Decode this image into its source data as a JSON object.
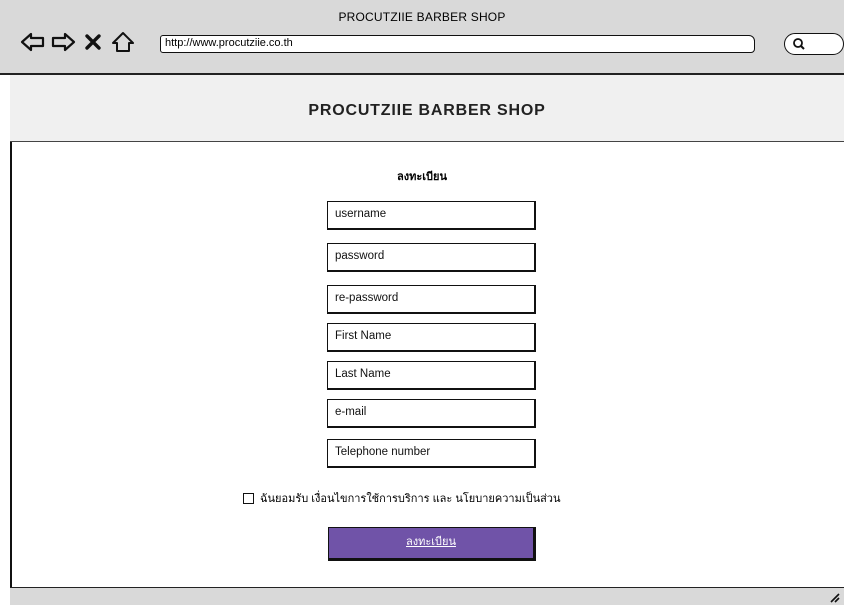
{
  "window": {
    "title": "PROCUTZIIE BARBER SHOP",
    "url": "http://www.procutziie.co.th"
  },
  "nav_icons": [
    "back-arrow-icon",
    "forward-arrow-icon",
    "close-icon",
    "home-icon"
  ],
  "header": {
    "title": "PROCUTZIIE BARBER SHOP"
  },
  "form": {
    "title": "ลงทะเบียน",
    "fields": {
      "username": "username",
      "password": "password",
      "repassword": "re-password",
      "firstname": "First Name",
      "lastname": "Last Name",
      "email": "e-mail",
      "telephone": "Telephone number"
    },
    "agree_label": "ฉันยอมรับ เงื่อนไขการใช้การบริการ และ นโยบายความเป็นส่วน",
    "submit_label": "ลงทะเบียน"
  },
  "colors": {
    "chrome": "#d9d9d9",
    "header": "#f0f0f0",
    "button": "#7053a8"
  }
}
